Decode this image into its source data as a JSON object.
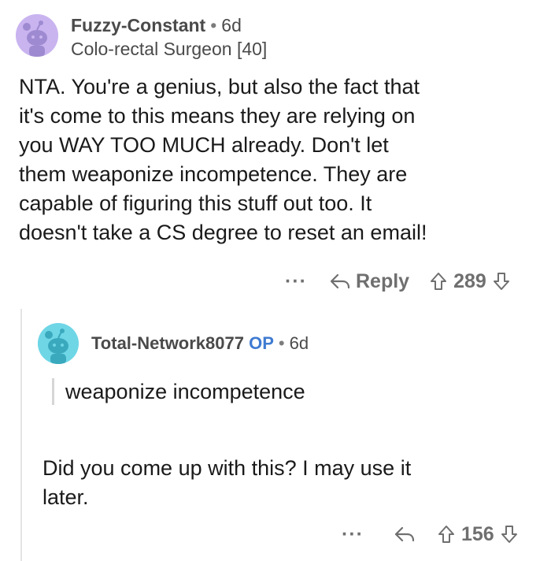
{
  "comment": {
    "username": "Fuzzy-Constant",
    "age": "6d",
    "flair": "Colo-rectal Surgeon [40]",
    "body_lines": [
      "NTA.  You're a genius, but also the fact that",
      "it's come to this means they are relying on",
      "you WAY TOO MUCH already.  Don't let",
      "them weaponize incompetence.  They are",
      "capable of figuring this stuff out too.  It",
      "doesn't take a CS degree to reset an email!"
    ],
    "more": "···",
    "reply_label": "Reply",
    "score": "289"
  },
  "reply": {
    "username": "Total-Network8077",
    "op_badge": "OP",
    "age": "6d",
    "quote": "weaponize incompetence",
    "body_lines": [
      "Did you come up with this? I may use it",
      "later."
    ],
    "more": "···",
    "score": "156"
  },
  "colors": {
    "avatar1_bg": "#c9b4f0",
    "avatar2_bg": "#6fd6e6",
    "op_blue": "#3f7bd2"
  },
  "icons": [
    "snoo-avatar-icon",
    "reply-arrow-icon",
    "upvote-arrow-icon",
    "downvote-arrow-icon"
  ]
}
